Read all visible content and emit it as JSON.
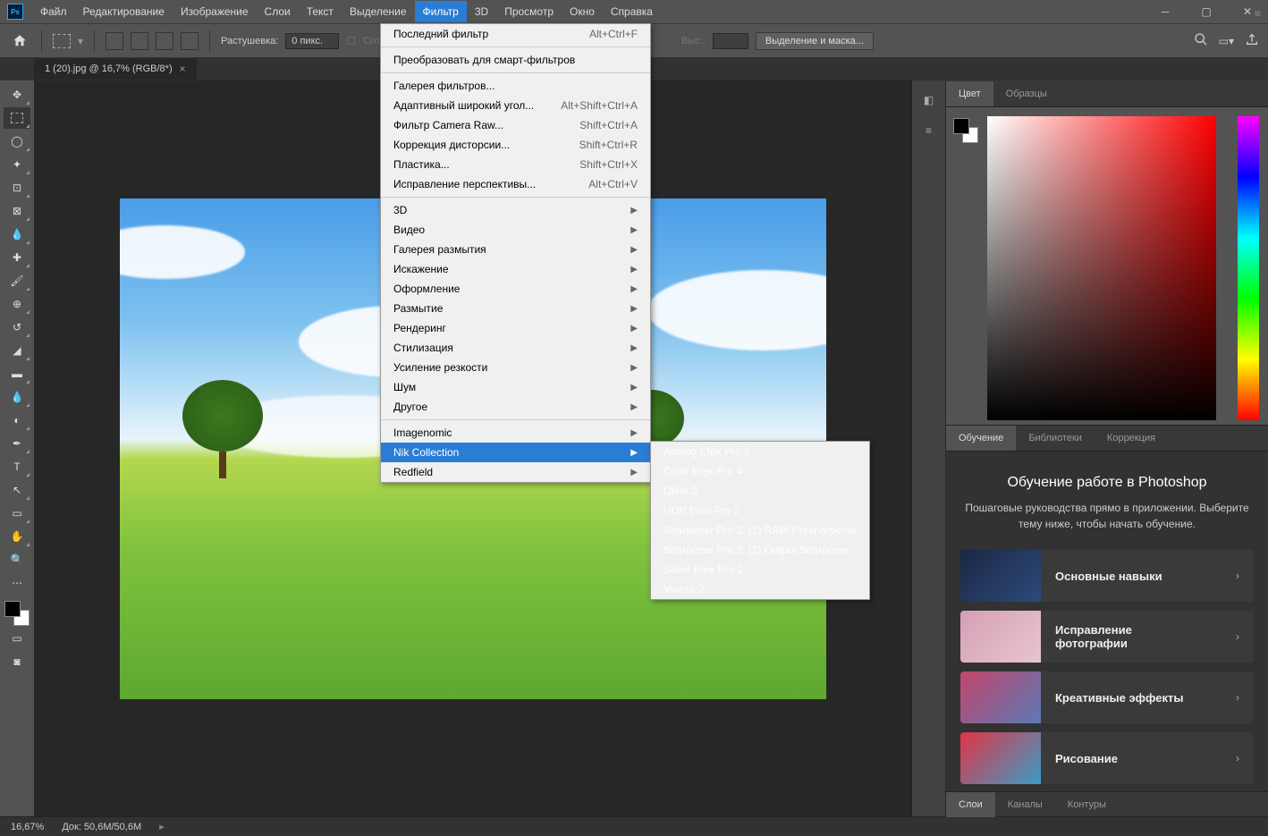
{
  "menubar": {
    "items": [
      "Файл",
      "Редактирование",
      "Изображение",
      "Слои",
      "Текст",
      "Выделение",
      "Фильтр",
      "3D",
      "Просмотр",
      "Окно",
      "Справка"
    ],
    "active_index": 6
  },
  "optbar": {
    "feather_label": "Растушевка:",
    "feather_value": "0 пикс.",
    "smoothing_label": "Сглаживание",
    "height_label": "Выс.:",
    "select_mask": "Выделение и маска..."
  },
  "doc_tab": {
    "name": "1 (20).jpg @ 16,7% (RGB/8*)"
  },
  "filter_menu": {
    "last_filter": {
      "label": "Последний фильтр",
      "shortcut": "Alt+Ctrl+F"
    },
    "convert_smart": {
      "label": "Преобразовать для смарт-фильтров"
    },
    "items1": [
      {
        "label": "Галерея фильтров..."
      },
      {
        "label": "Адаптивный широкий угол...",
        "shortcut": "Alt+Shift+Ctrl+A"
      },
      {
        "label": "Фильтр Camera Raw...",
        "shortcut": "Shift+Ctrl+A"
      },
      {
        "label": "Коррекция дисторсии...",
        "shortcut": "Shift+Ctrl+R"
      },
      {
        "label": "Пластика...",
        "shortcut": "Shift+Ctrl+X"
      },
      {
        "label": "Исправление перспективы...",
        "shortcut": "Alt+Ctrl+V"
      }
    ],
    "sub_groups": [
      "3D",
      "Видео",
      "Галерея размытия",
      "Искажение",
      "Оформление",
      "Размытие",
      "Рендеринг",
      "Стилизация",
      "Усиление резкости",
      "Шум",
      "Другое"
    ],
    "plugins": [
      "Imagenomic",
      "Nik Collection",
      "Redfield"
    ],
    "plugin_active_index": 1
  },
  "nik_submenu": [
    "Analog Efex Pro 2",
    "Color Efex Pro 4",
    "Dfine 2",
    "HDR Efex Pro 2",
    "Sharpener Pro 3: (1) RAW Presharpener",
    "Sharpener Pro 3: (2) Output Sharpener",
    "Silver Efex Pro 2",
    "Viveza 2"
  ],
  "color_tabs": [
    "Цвет",
    "Образцы"
  ],
  "bottom_tabs": [
    "Обучение",
    "Библиотеки",
    "Коррекция"
  ],
  "learn": {
    "title": "Обучение работе в Photoshop",
    "subtitle": "Пошаговые руководства прямо в приложении. Выберите тему ниже, чтобы начать обучение.",
    "cards": [
      "Основные навыки",
      "Исправление фотографии",
      "Креативные эффекты",
      "Рисование"
    ]
  },
  "footer_tabs": [
    "Слои",
    "Каналы",
    "Контуры"
  ],
  "statusbar": {
    "zoom": "16,67%",
    "doc": "Док: 50,6M/50,6M"
  }
}
